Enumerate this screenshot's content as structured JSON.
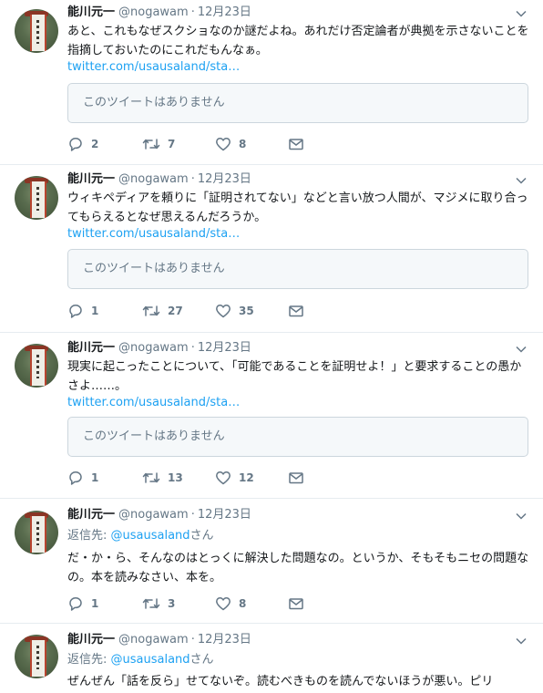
{
  "tweets": [
    {
      "name": "能川元一",
      "handle": "@nogawam",
      "sep": "·",
      "date": "12月23日",
      "reply_to": null,
      "text": "あと、これもなぜスクショなのか謎だよね。あれだけ否定論者が典拠を示さないことを指摘しておいたのにこれだもんなぁ。",
      "link": "twitter.com/usausaland/sta…",
      "quote": "このツイートはありません",
      "replies": "2",
      "retweets": "7",
      "likes": "8"
    },
    {
      "name": "能川元一",
      "handle": "@nogawam",
      "sep": "·",
      "date": "12月23日",
      "reply_to": null,
      "text": "ウィキペディアを頼りに「証明されてない」などと言い放つ人間が、マジメに取り合ってもらえるとなぜ思えるんだろうか。",
      "link": "twitter.com/usausaland/sta…",
      "quote": "このツイートはありません",
      "replies": "1",
      "retweets": "27",
      "likes": "35"
    },
    {
      "name": "能川元一",
      "handle": "@nogawam",
      "sep": "·",
      "date": "12月23日",
      "reply_to": null,
      "text": "現実に起こったことについて、「可能であることを証明せよ！」と要求することの愚かさよ……。",
      "link": "twitter.com/usausaland/sta…",
      "quote": "このツイートはありません",
      "replies": "1",
      "retweets": "13",
      "likes": "12"
    },
    {
      "name": "能川元一",
      "handle": "@nogawam",
      "sep": "·",
      "date": "12月23日",
      "reply_to": {
        "prefix": "返信先: ",
        "mention": "@usausaland",
        "suffix": "さん"
      },
      "text": "だ・か・ら、そんなのはとっくに解決した問題なの。というか、そもそもニセの問題なの。本を読みなさい、本を。",
      "link": null,
      "quote": null,
      "replies": "1",
      "retweets": "3",
      "likes": "8"
    },
    {
      "name": "能川元一",
      "handle": "@nogawam",
      "sep": "·",
      "date": "12月23日",
      "reply_to": {
        "prefix": "返信先: ",
        "mention": "@usausaland",
        "suffix": "さん"
      },
      "text": "ぜんぜん「話を反ら」せてないぞ。読むべきものを読んでないほうが悪い。ピリ",
      "link": null,
      "quote": null,
      "replies": "",
      "retweets": "",
      "likes": ""
    }
  ],
  "icons": {
    "reply": "reply-icon",
    "retweet": "retweet-icon",
    "like": "heart-icon",
    "dm": "envelope-icon",
    "menu": "chevron-down-icon"
  },
  "colors": {
    "link": "#1da1f2",
    "meta": "#657786",
    "border": "#e6ecf0"
  }
}
